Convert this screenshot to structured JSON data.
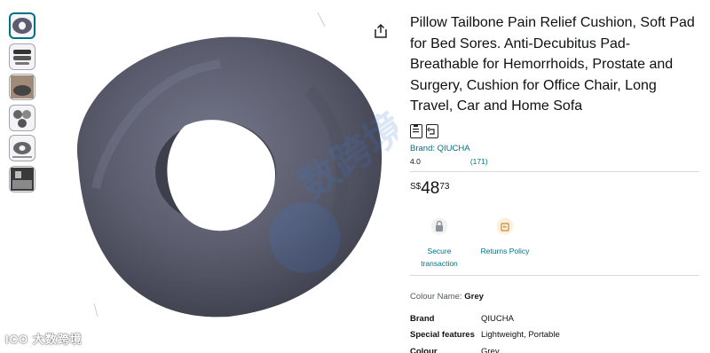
{
  "product": {
    "title": "Pillow Tailbone Pain Relief Cushion, Soft Pad for Bed Sores. Anti-Decubitus Pad- Breathable for Hemorrhoids, Prostate and Surgery, Cushion for Office Chair, Long Travel, Car and Home Sofa",
    "brand_link": "Brand: QIUCHA",
    "rating": "4.0",
    "review_count": "(171)",
    "price": {
      "currency": "S$",
      "whole": "48",
      "fraction": "73"
    }
  },
  "features": [
    {
      "icon": "lock-icon",
      "label": "Secure transaction"
    },
    {
      "icon": "return-box-icon",
      "label": "Returns Policy"
    }
  ],
  "colour": {
    "label": "Colour Name:",
    "value": "Grey"
  },
  "specs": [
    {
      "key": "Brand",
      "value": "QIUCHA"
    },
    {
      "key": "Special features",
      "value": "Lightweight, Portable"
    },
    {
      "key": "Colour",
      "value": "Grey"
    }
  ],
  "thumbnails": [
    {
      "icon": "cushion-ring-icon"
    },
    {
      "icon": "cushion-parts-icon"
    },
    {
      "icon": "cushion-use-icon"
    },
    {
      "icon": "cushion-detail-icon"
    },
    {
      "icon": "cushion-size-icon"
    },
    {
      "icon": "cushion-lifestyle-icon"
    }
  ],
  "watermark": "ICO 大数跨境",
  "colors": {
    "link": "#007185",
    "text": "#0f1111",
    "cushion": "#5b5d6e",
    "divider": "#d5d9d9"
  }
}
